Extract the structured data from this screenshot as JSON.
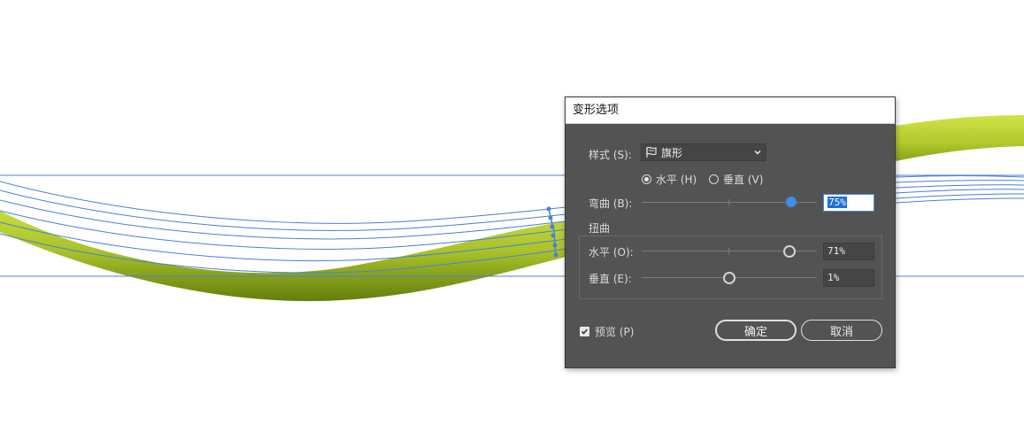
{
  "dialog": {
    "title": "变形选项",
    "style_label": "样式 (S):",
    "style_value": "旗形",
    "orientation": {
      "horizontal_label": "水平 (H)",
      "vertical_label": "垂直 (V)",
      "selected": "horizontal"
    },
    "bend": {
      "label": "弯曲 (B):",
      "value_text": "75%",
      "value": 75
    },
    "distortion": {
      "group_label": "扭曲",
      "horizontal": {
        "label": "水平 (O):",
        "value_text": "71%",
        "value": 71
      },
      "vertical": {
        "label": "垂直 (E):",
        "value_text": "1%",
        "value": 1
      }
    },
    "preview": {
      "label": "预览 (P)",
      "checked": true
    },
    "ok_label": "确定",
    "cancel_label": "取消"
  },
  "colors": {
    "guide_blue": "#4a7fd6",
    "stroke_green_light": "#c4d93a",
    "stroke_green_dark": "#6e8c10",
    "dialog_bg": "#535353",
    "accent": "#3d8ee8"
  },
  "icons": [
    "flag-icon",
    "chevron-down-icon",
    "radio-icon",
    "checkbox-icon",
    "slider-thumb-icon"
  ]
}
